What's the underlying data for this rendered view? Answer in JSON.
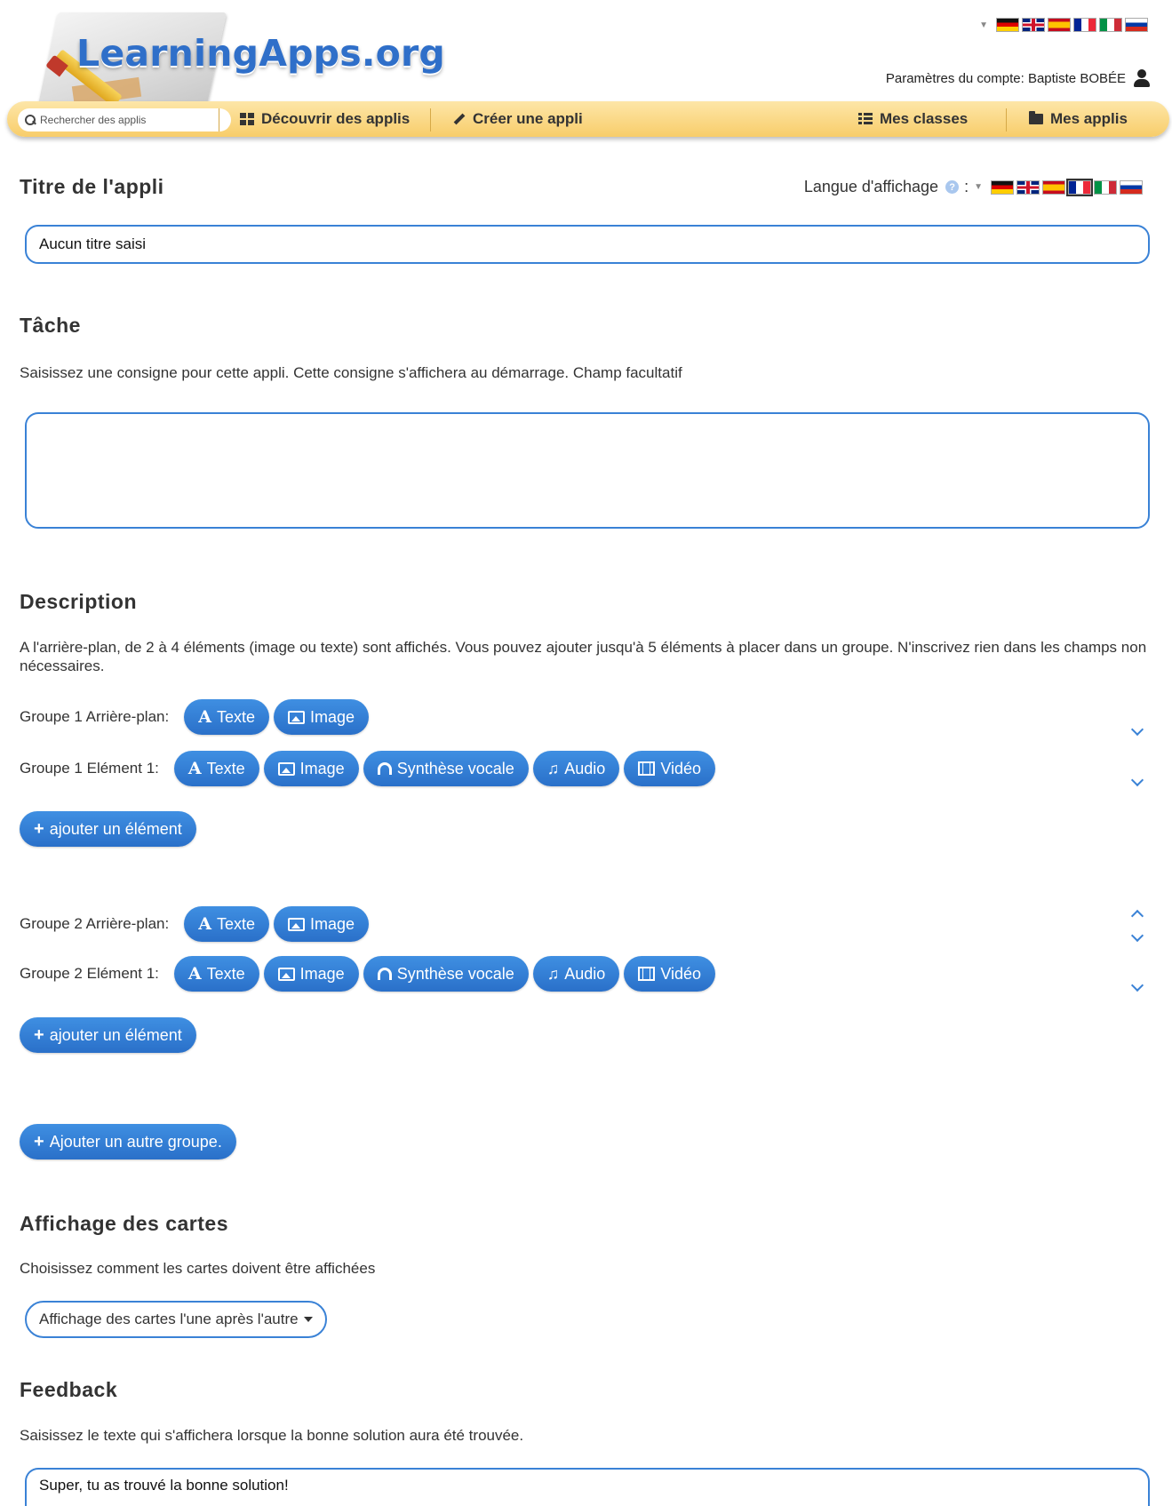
{
  "header": {
    "logo_text": "LearningApps.org",
    "account_label": "Paramètres du compte: Baptiste BOBÉE",
    "languages": [
      "de",
      "en",
      "es",
      "fr",
      "it",
      "ru"
    ]
  },
  "nav": {
    "search_placeholder": "Rechercher des applis",
    "discover": "Découvrir des applis",
    "create": "Créer une appli",
    "classes": "Mes classes",
    "my_apps": "Mes applis"
  },
  "title_section": {
    "heading": "Titre de l'appli",
    "display_language_label": "Langue d'affichage",
    "help_glyph": "?",
    "colon": ":",
    "value": "Aucun titre saisi"
  },
  "task_section": {
    "heading": "Tâche",
    "hint": "Saisissez une consigne pour cette appli. Cette consigne s'affichera au démarrage. Champ facultatif",
    "value": ""
  },
  "description_section": {
    "heading": "Description",
    "text": "A l'arrière-plan, de 2 à 4 éléments (image ou texte) sont affichés. Vous pouvez ajouter jusqu'à 5 éléments à placer dans un groupe. N'inscrivez rien dans les champs non nécessaires.",
    "groups": [
      {
        "background_label": "Groupe 1 Arrière-plan:",
        "element_label": "Groupe 1 Elément 1:",
        "add_element": "ajouter un élément"
      },
      {
        "background_label": "Groupe 2 Arrière-plan:",
        "element_label": "Groupe 2 Elément 1:",
        "add_element": "ajouter un élément"
      }
    ],
    "buttons": {
      "text": "Texte",
      "text_glyph": "A",
      "image": "Image",
      "tts": "Synthèse vocale",
      "audio": "Audio",
      "audio_glyph": "♫",
      "video": "Vidéo",
      "plus_glyph": "+"
    },
    "add_group": "Ajouter un autre groupe."
  },
  "cards_section": {
    "heading": "Affichage des cartes",
    "hint": "Choisissez comment les cartes doivent être affichées",
    "selected": "Affichage des cartes l'une après l'autre"
  },
  "feedback_section": {
    "heading": "Feedback",
    "hint": "Saisissez le texte qui s'affichera lorsque la bonne solution aura été trouvée.",
    "value": "Super, tu as trouvé la bonne solution!"
  }
}
